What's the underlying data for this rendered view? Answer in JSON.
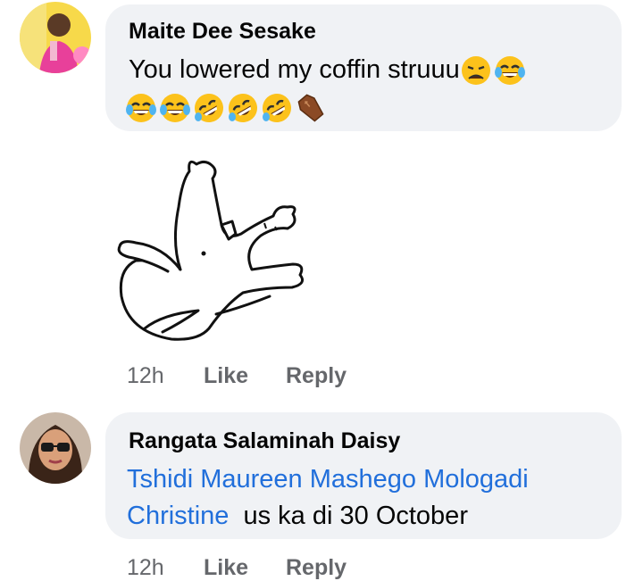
{
  "comments": [
    {
      "author": "Maite Dee Sesake",
      "text_line1": "You lowered my coffin struuu",
      "emojis_line1": [
        "weary-face-emoji",
        "tears-of-joy-emoji"
      ],
      "emojis_line2": [
        "tears-of-joy-emoji",
        "tears-of-joy-emoji",
        "rolling-laughing-emoji",
        "rolling-laughing-emoji",
        "rolling-laughing-emoji",
        "coffin-emoji"
      ],
      "sticker": "dancing-white-bird-sticker",
      "time": "12h",
      "like_label": "Like",
      "reply_label": "Reply"
    },
    {
      "author": "Rangata Salaminah Daisy",
      "mention_line1": "Tshidi Maureen Mashego Mologadi",
      "mention_line2": "Christine",
      "text_after_mention": "us ka di 30 October",
      "time": "12h",
      "like_label": "Like",
      "reply_label": "Reply"
    }
  ],
  "colors": {
    "bubble": "#f0f2f5",
    "mention": "#216fdb",
    "meta": "#65676b",
    "text": "#050505"
  }
}
